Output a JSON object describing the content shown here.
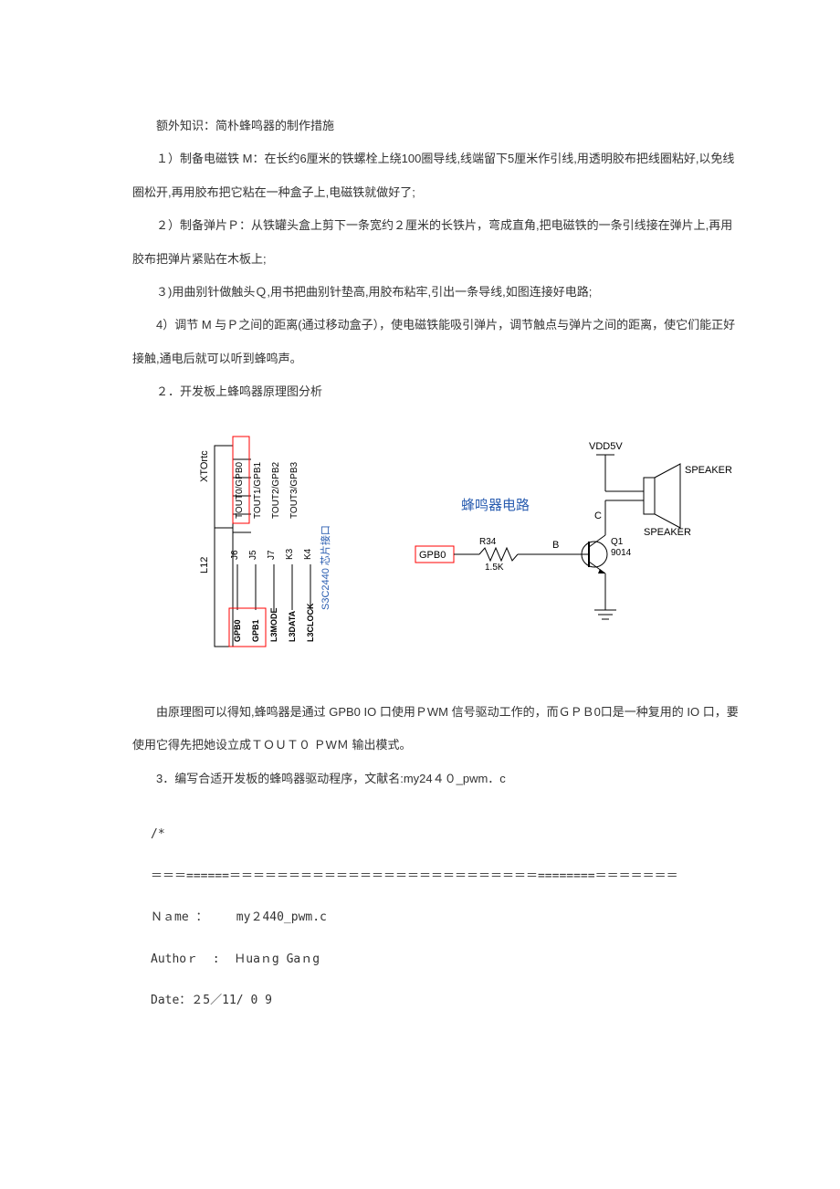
{
  "p_intro": "额外知识：简朴蜂鸣器的制作措施",
  "p_step1": "１）制备电磁铁 M：在长约6厘米的铁螺栓上绕100圈导线,线端留下5厘米作引线,用透明胶布把线圈粘好,以免线圈松开,再用胶布把它粘在一种盒子上,电磁铁就做好了;",
  "p_step2": "２）制备弹片Ｐ：从铁罐头盒上剪下一条宽约２厘米的长铁片，弯成直角,把电磁铁的一条引线接在弹片上,再用胶布把弹片紧贴在木板上;",
  "p_step3": "３)用曲别针做触头Ｑ,用书把曲别针垫高,用胶布粘牢,引出一条导线,如图连接好电路;",
  "p_step4": "4）调节 M 与Ｐ之间的距离(通过移动盒子），使电磁铁能吸引弹片，调节触点与弹片之间的距离，使它们能正好接触,通电后就可以听到蜂鸣声。",
  "p_section2": "２．开发板上蜂鸣器原理图分析",
  "p_analysis": "由原理图可以得知,蜂鸣器是通过 GPB0 IO 口使用ＰWM 信号驱动工作的，而ＧＰＢ0口是一种复用的 IO 口，要使用它得先把她设立成ＴＯＵＴ０ ＰWＭ 输出模式。",
  "p_section3": "3．编写合适开发板的蜂鸣器驱动程序，文献名:my24４０_pwm．c",
  "code": {
    "l1": "/*",
    "l2": "＝＝＝======＝＝＝＝＝＝＝＝＝＝＝＝＝＝＝＝＝＝＝＝＝＝＝＝＝＝========＝＝＝＝＝＝＝",
    "l3": "Ｎａme ：    my２440_pwm.c",
    "l4": "Authoｒ  :  Ｈuaｎg Gaｎg",
    "l5": "Date：２5／11/ 0 9"
  },
  "diagram": {
    "title": "蜂鸣器电路",
    "left_top": "XTOrtc",
    "left_bot": "L12",
    "row_gpb0": "GPB0",
    "row_gpb1": "GPB1",
    "row_l3mode": "L3MODE",
    "row_l3data": "L3DATA",
    "row_l3clock": "L3CLOCK",
    "j6": "J6",
    "j5": "J5",
    "j7": "J7",
    "k3": "K3",
    "k4": "K4",
    "t0": "TOUT0/GPB0",
    "t1": "TOUT1/GPB1",
    "t2": "TOUT2/GPB2",
    "t3": "TOUT3/GPB3",
    "chip": "S3C2440 芯片接口",
    "gpb0_box": "GPB0",
    "r34": "R34",
    "r34v": "1.5K",
    "node_b": "B",
    "node_c": "C",
    "q1": "Q1",
    "q1v": "9014",
    "vdd": "VDD5V",
    "spk1": "SPEAKER",
    "spk2": "SPEAKER"
  }
}
